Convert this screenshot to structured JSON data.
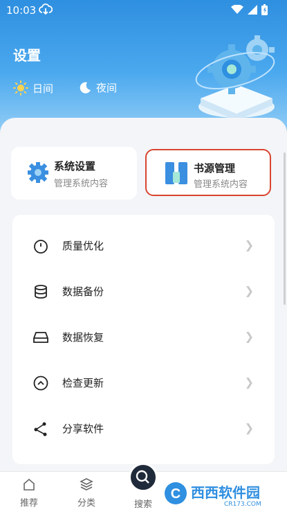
{
  "status": {
    "time": "10:03"
  },
  "header": {
    "title": "设置"
  },
  "modes": {
    "day": "日间",
    "night": "夜间"
  },
  "cards": [
    {
      "title": "系统设置",
      "subtitle": "管理系统内容",
      "icon": "gear-icon"
    },
    {
      "title": "书源管理",
      "subtitle": "管理系统内容",
      "icon": "book-source-icon"
    }
  ],
  "settings_list": [
    {
      "label": "质量优化",
      "icon": "timer-icon"
    },
    {
      "label": "数据备份",
      "icon": "database-icon"
    },
    {
      "label": "数据恢复",
      "icon": "drive-icon"
    },
    {
      "label": "检查更新",
      "icon": "chevron-up-circle-icon"
    },
    {
      "label": "分享软件",
      "icon": "share-icon"
    }
  ],
  "tabs": [
    {
      "label": "推荐",
      "icon": "home-icon"
    },
    {
      "label": "分类",
      "icon": "layers-icon"
    },
    {
      "label": "搜索",
      "icon": "search-icon"
    }
  ],
  "watermark": {
    "text": "西西软件园",
    "sub": "CR173.COM"
  },
  "colors": {
    "accent": "#3a8fe0",
    "highlight_border": "#d9442f"
  }
}
